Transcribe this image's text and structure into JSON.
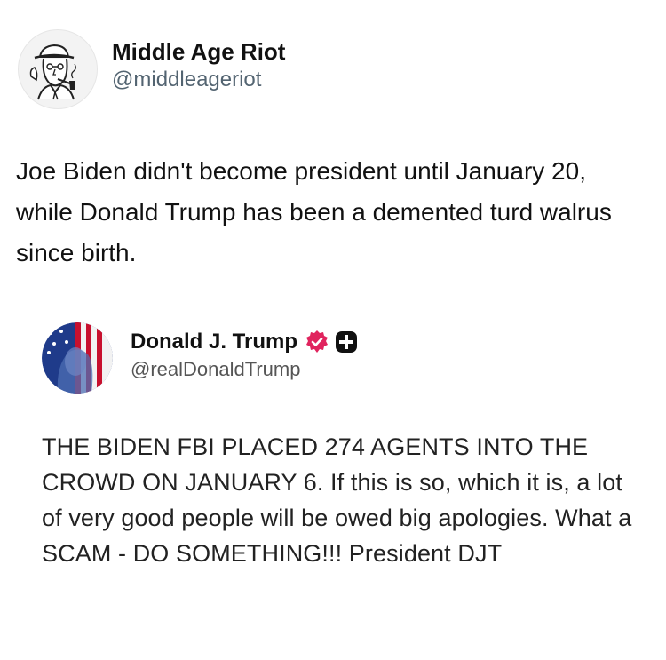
{
  "outer_post": {
    "display_name": "Middle Age Riot",
    "handle": "@middleageriot",
    "body": "Joe Biden didn't become president until January 20, while Donald Trump has been a demented turd walrus since birth."
  },
  "quoted_post": {
    "display_name": "Donald J. Trump",
    "handle": "@realDonaldTrump",
    "verified_badge_color": "#e0245e",
    "body": "THE BIDEN FBI PLACED 274 AGENTS INTO THE CROWD ON JANUARY 6. If this is so, which it is, a lot of very good people will be owed big apologies. What a SCAM - DO SOMETHING!!! President DJT"
  },
  "icons": {
    "outer_avatar": "man-with-pipe-sketch-avatar",
    "inner_avatar": "flag-portrait-avatar",
    "verified": "verified-badge-icon",
    "plus": "plus-icon"
  }
}
